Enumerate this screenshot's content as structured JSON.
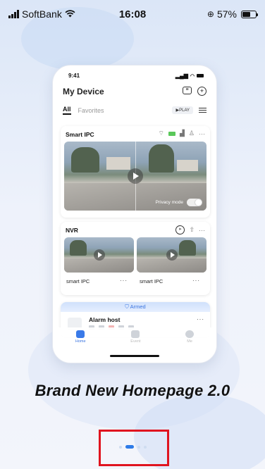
{
  "statusbar": {
    "carrier": "SoftBank",
    "time": "16:08",
    "battery": "57%",
    "battery_level": 0.57
  },
  "phone_preview": {
    "time": "9:41",
    "title": "My Device",
    "tabs": [
      "All",
      "Favorites"
    ],
    "play_label": "▶PLAY",
    "device1": {
      "name": "Smart IPC",
      "privacy_label": "Privacy mode"
    },
    "device2": {
      "name": "NVR",
      "channels": [
        "smart IPC",
        "smart IPC"
      ],
      "more": "···"
    },
    "device3": {
      "status": "Armed",
      "name": "Alarm host",
      "more": "···"
    },
    "nav": [
      "Home",
      "Event",
      "Me"
    ]
  },
  "headline": "Brand New Homepage 2.0",
  "pager": {
    "count": 4,
    "active_index": 1
  },
  "colors": {
    "accent": "#2e7be8",
    "highlight_box": "#e0141f"
  }
}
